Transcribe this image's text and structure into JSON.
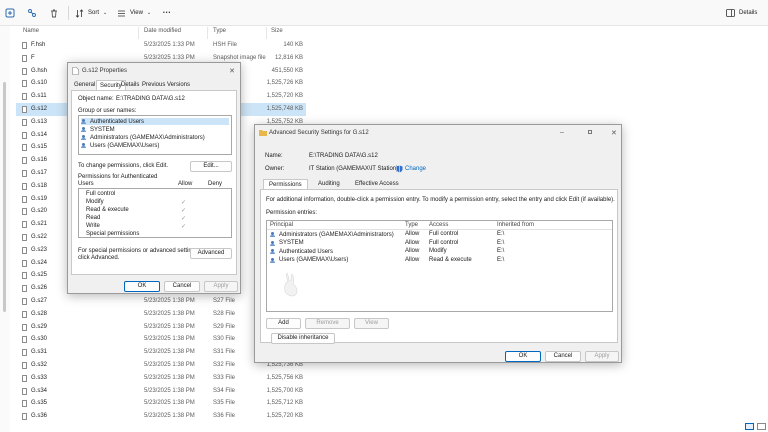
{
  "toolbar": {
    "sort_label": "Sort",
    "view_label": "View",
    "more_label": "•••",
    "details_label": "Details"
  },
  "columns": {
    "name": "Name",
    "date": "Date modified",
    "type": "Type",
    "size": "Size"
  },
  "files": [
    {
      "name": "F.hsh",
      "date": "5/23/2025 1:33 PM",
      "type": "HSH File",
      "size": "140 KB"
    },
    {
      "name": "F",
      "date": "5/23/2025 1:33 PM",
      "type": "Snapshot image file",
      "size": "12,816 KB"
    },
    {
      "name": "G.hsh",
      "date": "",
      "type": "",
      "size": "451,550 KB"
    },
    {
      "name": "G.s10",
      "date": "",
      "type": "",
      "size": "1,525,726 KB"
    },
    {
      "name": "G.s11",
      "date": "",
      "type": "",
      "size": "1,525,720 KB"
    },
    {
      "name": "G.s12",
      "date": "",
      "type": "",
      "size": "1,525,748 KB"
    },
    {
      "name": "G.s13",
      "date": "",
      "type": "",
      "size": "1,525,752 KB"
    },
    {
      "name": "G.s14",
      "date": "",
      "type": "",
      "size": ""
    },
    {
      "name": "G.s15",
      "date": "",
      "type": "",
      "size": ""
    },
    {
      "name": "G.s16",
      "date": "",
      "type": "",
      "size": ""
    },
    {
      "name": "G.s17",
      "date": "",
      "type": "",
      "size": ""
    },
    {
      "name": "G.s18",
      "date": "",
      "type": "",
      "size": ""
    },
    {
      "name": "G.s19",
      "date": "",
      "type": "",
      "size": ""
    },
    {
      "name": "G.s20",
      "date": "",
      "type": "",
      "size": ""
    },
    {
      "name": "G.s21",
      "date": "",
      "type": "",
      "size": ""
    },
    {
      "name": "G.s22",
      "date": "",
      "type": "",
      "size": ""
    },
    {
      "name": "G.s23",
      "date": "",
      "type": "",
      "size": ""
    },
    {
      "name": "G.s24",
      "date": "",
      "type": "",
      "size": ""
    },
    {
      "name": "G.s25",
      "date": "",
      "type": "",
      "size": ""
    },
    {
      "name": "G.s26",
      "date": "",
      "type": "",
      "size": ""
    },
    {
      "name": "G.s27",
      "date": "5/23/2025 1:38 PM",
      "type": "S27 File",
      "size": ""
    },
    {
      "name": "G.s28",
      "date": "5/23/2025 1:38 PM",
      "type": "S28 File",
      "size": ""
    },
    {
      "name": "G.s29",
      "date": "5/23/2025 1:38 PM",
      "type": "S29 File",
      "size": ""
    },
    {
      "name": "G.s30",
      "date": "5/23/2025 1:38 PM",
      "type": "S30 File",
      "size": ""
    },
    {
      "name": "G.s31",
      "date": "5/23/2025 1:38 PM",
      "type": "S31 File",
      "size": ""
    },
    {
      "name": "G.s32",
      "date": "5/23/2025 1:38 PM",
      "type": "S32 File",
      "size": "1,525,736 KB"
    },
    {
      "name": "G.s33",
      "date": "5/23/2025 1:38 PM",
      "type": "S33 File",
      "size": "1,525,756 KB"
    },
    {
      "name": "G.s34",
      "date": "5/23/2025 1:38 PM",
      "type": "S34 File",
      "size": "1,525,700 KB"
    },
    {
      "name": "G.s35",
      "date": "5/23/2025 1:38 PM",
      "type": "S35 File",
      "size": "1,525,712 KB"
    },
    {
      "name": "G.s36",
      "date": "5/23/2025 1:38 PM",
      "type": "S36 File",
      "size": "1,525,720 KB"
    }
  ],
  "props": {
    "title": "G.s12 Properties",
    "tabs": [
      "General",
      "Security",
      "Details",
      "Previous Versions"
    ],
    "object_label": "Object name:",
    "object_value": "E:\\TRADING DATA\\G.s12",
    "group_label": "Group or user names:",
    "groups": [
      "Authenticated Users",
      "SYSTEM",
      "Administrators (GAMEMAX\\Administrators)",
      "Users (GAMEMAX\\Users)"
    ],
    "change_text": "To change permissions, click Edit.",
    "edit_btn": "Edit...",
    "perm_for_l1": "Permissions for Authenticated",
    "perm_for_l2": "Users",
    "allow_label": "Allow",
    "deny_label": "Deny",
    "perms": [
      {
        "name": "Full control",
        "allow": ""
      },
      {
        "name": "Modify",
        "allow": "✓"
      },
      {
        "name": "Read & execute",
        "allow": "✓"
      },
      {
        "name": "Read",
        "allow": "✓"
      },
      {
        "name": "Write",
        "allow": "✓"
      },
      {
        "name": "Special permissions",
        "allow": ""
      }
    ],
    "special_l1": "For special permissions or advanced settings,",
    "special_l2": "click Advanced.",
    "advanced_btn": "Advanced",
    "ok": "OK",
    "cancel": "Cancel",
    "apply": "Apply"
  },
  "adv": {
    "title": "Advanced Security Settings for G.s12",
    "name_label": "Name:",
    "name_value": "E:\\TRADING DATA\\G.s12",
    "owner_label": "Owner:",
    "owner_value": "IT Station (GAMEMAX\\IT Station)",
    "change_link": "Change",
    "tabs": [
      "Permissions",
      "Auditing",
      "Effective Access"
    ],
    "info": "For additional information, double-click a permission entry. To modify a permission entry, select the entry and click Edit (if available).",
    "entries_label": "Permission entries:",
    "col_principal": "Principal",
    "col_type": "Type",
    "col_access": "Access",
    "col_inherited": "Inherited from",
    "entries": [
      {
        "principal": "Administrators (GAMEMAX\\Administrators)",
        "type": "Allow",
        "access": "Full control",
        "inherited": "E:\\"
      },
      {
        "principal": "SYSTEM",
        "type": "Allow",
        "access": "Full control",
        "inherited": "E:\\"
      },
      {
        "principal": "Authenticated Users",
        "type": "Allow",
        "access": "Modify",
        "inherited": "E:\\"
      },
      {
        "principal": "Users (GAMEMAX\\Users)",
        "type": "Allow",
        "access": "Read & execute",
        "inherited": "E:\\"
      }
    ],
    "add_btn": "Add",
    "remove_btn": "Remove",
    "view_btn": "View",
    "disable_btn": "Disable inheritance",
    "ok": "OK",
    "cancel": "Cancel",
    "apply": "Apply"
  },
  "colors": {
    "accent": "#0067c0",
    "selection": "#cce4f7",
    "folder": "#e8b84a"
  }
}
